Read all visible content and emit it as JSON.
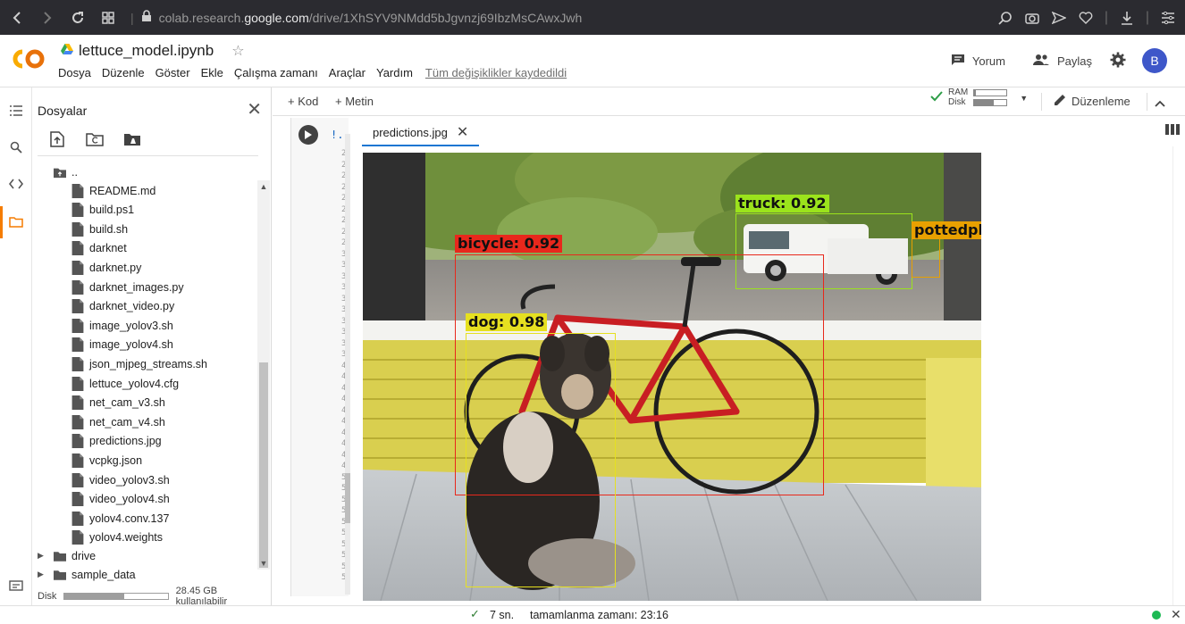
{
  "browser": {
    "url_prefix": "colab.research.",
    "url_host": "google.com",
    "url_path": "/drive/1XhSYV9NMdd5bJgvnzj69IbzMsCAwxJwh"
  },
  "header": {
    "notebook_title": "lettuce_model.ipynb",
    "menu": [
      "Dosya",
      "Düzenle",
      "Göster",
      "Ekle",
      "Çalışma zamanı",
      "Araçlar",
      "Yardım"
    ],
    "saved_status": "Tüm değişiklikler kaydedildi",
    "comment_label": "Yorum",
    "share_label": "Paylaş",
    "avatar_letter": "B"
  },
  "files": {
    "title": "Dosyalar",
    "parent": "..",
    "items": [
      "README.md",
      "build.ps1",
      "build.sh",
      "darknet",
      "darknet.py",
      "darknet_images.py",
      "darknet_video.py",
      "image_yolov3.sh",
      "image_yolov4.sh",
      "json_mjpeg_streams.sh",
      "lettuce_yolov4.cfg",
      "net_cam_v3.sh",
      "net_cam_v4.sh",
      "predictions.jpg",
      "vcpkg.json",
      "video_yolov3.sh",
      "video_yolov4.sh",
      "yolov4.conv.137",
      "yolov4.weights"
    ],
    "folders": [
      "drive",
      "sample_data"
    ],
    "disk_label": "Disk",
    "disk_usage_text": "28.45 GB kullanılabilir",
    "disk_used_fraction": 0.58
  },
  "toolbar": {
    "add_code": "+ Kod",
    "add_text": "+ Metin",
    "ram_label": "RAM",
    "disk_label": "Disk",
    "ram_fraction": 0.05,
    "disk_fraction": 0.6,
    "edit_label": "Düzenleme"
  },
  "cell": {
    "code_start": "!.",
    "line_numbers": [
      "2",
      "2",
      "2",
      "2",
      "2",
      "2",
      "2",
      "2",
      "2",
      "3",
      "3",
      "3",
      "3",
      "3",
      "3",
      "3",
      "3",
      "3",
      "3",
      "4",
      "4",
      "4",
      "4",
      "4",
      "4",
      "4",
      "4",
      "4",
      "4",
      "5",
      "5",
      "5",
      "5",
      "5",
      "5",
      "5",
      "5",
      "5",
      "5"
    ]
  },
  "viewer": {
    "tab_label": "predictions.jpg",
    "detections": [
      {
        "label": "truck: 0.92",
        "color": "#9be31c"
      },
      {
        "label": "pottedplant",
        "color": "#e8a000"
      },
      {
        "label": "bicycle: 0.92",
        "color": "#e8281c"
      },
      {
        "label": "dog: 0.98",
        "color": "#e6e020"
      }
    ]
  },
  "status": {
    "duration": "7 sn.",
    "completed": "tamamlanma zamanı: 23:16"
  }
}
